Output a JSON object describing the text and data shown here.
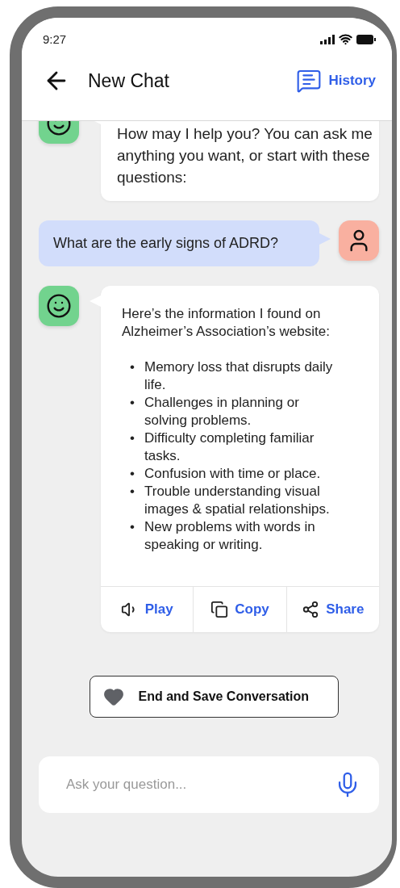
{
  "status_bar": {
    "time": "9:27"
  },
  "header": {
    "title": "New Chat",
    "history_label": "History"
  },
  "messages": [
    {
      "kind": "bot",
      "text": "How may I help you? You can ask me anything you want, or start with these questions:"
    },
    {
      "kind": "user",
      "text": "What are the early signs of ADRD?"
    },
    {
      "kind": "bot",
      "text": "Here’s the information I found on Alzheimer’s Association’s website:",
      "bullets": [
        {
          "marker": "•",
          "text": "Memory loss that disrupts daily life."
        },
        {
          "marker": "•",
          "text": "Challenges in planning or solving problems."
        },
        {
          "marker": "•",
          "text": "Difficulty completing familiar tasks."
        },
        {
          "marker": "•",
          "text": "Confusion with time or place."
        },
        {
          "marker": "•",
          "text": "Trouble understanding visual images & spatial relationships."
        },
        {
          "marker": "•",
          "text": "New problems with words in speaking or writing."
        }
      ],
      "actions": [
        {
          "kind": "play",
          "label": "Play"
        },
        {
          "kind": "copy",
          "label": "Copy"
        },
        {
          "kind": "share",
          "label": "Share"
        }
      ]
    }
  ],
  "end_button": {
    "label": "End and Save Conversation"
  },
  "input": {
    "placeholder": "Ask your question..."
  }
}
